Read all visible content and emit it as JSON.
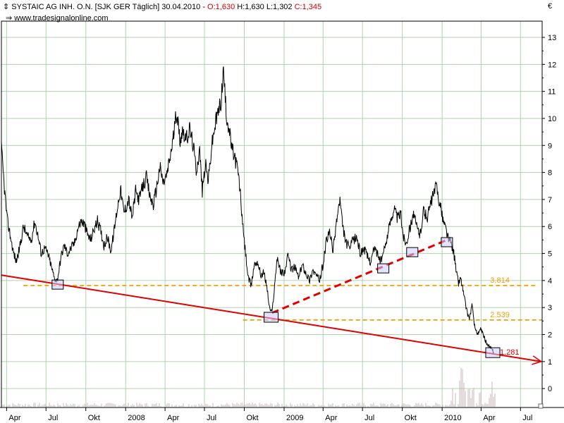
{
  "header": {
    "title": "SYSTAIC AG INH. O.N. [SJK GER  Täglich] 30.04.2010 - ",
    "open": "O:1,630",
    "high": "H:1,630",
    "low": "L:1,302",
    "close": "C:1,345",
    "source": "www.tradesignalonline.com",
    "currency": "€"
  },
  "colors": {
    "price": "#000000",
    "grid": "#b0d0b0",
    "trend": "#e00000",
    "level": "#f0a000",
    "box": "#ccccff",
    "volume": "#c8b8b8"
  },
  "chart_data": {
    "type": "line",
    "title": "SYSTAIC AG INH. O.N. [SJK GER  Täglich] 30.04.2010",
    "xlabel": "",
    "ylabel": "€",
    "xlim": [
      "2007-03-20",
      "2010-08-20"
    ],
    "ylim": [
      -0.7,
      13.6
    ],
    "yticks": [
      0,
      1,
      2,
      3,
      4,
      5,
      6,
      7,
      8,
      9,
      10,
      11,
      12,
      13
    ],
    "xticks": [
      {
        "label": "Apr",
        "date": "2007-04-01"
      },
      {
        "label": "Jul",
        "date": "2007-07-01"
      },
      {
        "label": "Okt",
        "date": "2007-10-01"
      },
      {
        "label": "2008",
        "date": "2008-01-01"
      },
      {
        "label": "Apr",
        "date": "2008-04-01"
      },
      {
        "label": "Jul",
        "date": "2008-07-01"
      },
      {
        "label": "Okt",
        "date": "2008-10-01"
      },
      {
        "label": "2009",
        "date": "2009-01-01"
      },
      {
        "label": "Apr",
        "date": "2009-04-01"
      },
      {
        "label": "Jul",
        "date": "2009-07-01"
      },
      {
        "label": "Okt",
        "date": "2009-10-01"
      },
      {
        "label": "2010",
        "date": "2010-01-01"
      },
      {
        "label": "Apr",
        "date": "2010-04-01"
      },
      {
        "label": "Jul",
        "date": "2010-07-01"
      }
    ],
    "grid": true,
    "series": [
      {
        "values": [
          [
            "2007-03-20",
            8.9
          ],
          [
            "2007-03-26",
            7.6
          ],
          [
            "2007-04-02",
            6.3
          ],
          [
            "2007-04-09",
            5.7
          ],
          [
            "2007-04-16",
            5.1
          ],
          [
            "2007-04-23",
            4.7
          ],
          [
            "2007-05-01",
            5.2
          ],
          [
            "2007-05-10",
            6.0
          ],
          [
            "2007-05-20",
            5.6
          ],
          [
            "2007-05-28",
            5.5
          ],
          [
            "2007-06-05",
            6.2
          ],
          [
            "2007-06-12",
            5.7
          ],
          [
            "2007-06-20",
            5.0
          ],
          [
            "2007-06-28",
            5.2
          ],
          [
            "2007-07-05",
            5.0
          ],
          [
            "2007-07-12",
            4.6
          ],
          [
            "2007-07-20",
            4.1
          ],
          [
            "2007-07-27",
            4.0
          ],
          [
            "2007-08-05",
            4.9
          ],
          [
            "2007-08-12",
            5.3
          ],
          [
            "2007-08-20",
            5.0
          ],
          [
            "2007-08-28",
            5.2
          ],
          [
            "2007-09-05",
            5.4
          ],
          [
            "2007-09-12",
            5.9
          ],
          [
            "2007-09-20",
            6.2
          ],
          [
            "2007-09-27",
            6.1
          ],
          [
            "2007-10-05",
            5.7
          ],
          [
            "2007-10-12",
            5.5
          ],
          [
            "2007-10-20",
            5.9
          ],
          [
            "2007-10-28",
            6.2
          ],
          [
            "2007-11-05",
            5.8
          ],
          [
            "2007-11-12",
            5.3
          ],
          [
            "2007-11-20",
            5.6
          ],
          [
            "2007-11-28",
            5.1
          ],
          [
            "2007-12-05",
            5.8
          ],
          [
            "2007-12-12",
            6.6
          ],
          [
            "2007-12-20",
            7.4
          ],
          [
            "2007-12-28",
            6.5
          ],
          [
            "2008-01-08",
            7.0
          ],
          [
            "2008-01-16",
            6.3
          ],
          [
            "2008-01-24",
            7.3
          ],
          [
            "2008-02-01",
            7.0
          ],
          [
            "2008-02-10",
            7.5
          ],
          [
            "2008-02-18",
            7.8
          ],
          [
            "2008-02-26",
            7.1
          ],
          [
            "2008-03-05",
            6.8
          ],
          [
            "2008-03-12",
            7.4
          ],
          [
            "2008-03-20",
            8.2
          ],
          [
            "2008-03-28",
            7.6
          ],
          [
            "2008-04-05",
            7.9
          ],
          [
            "2008-04-12",
            8.5
          ],
          [
            "2008-04-20",
            9.3
          ],
          [
            "2008-04-28",
            10.3
          ],
          [
            "2008-05-05",
            9.2
          ],
          [
            "2008-05-12",
            9.6
          ],
          [
            "2008-05-20",
            9.2
          ],
          [
            "2008-05-28",
            9.6
          ],
          [
            "2008-06-05",
            9.0
          ],
          [
            "2008-06-12",
            8.1
          ],
          [
            "2008-06-20",
            8.8
          ],
          [
            "2008-06-26",
            7.3
          ],
          [
            "2008-07-03",
            8.3
          ],
          [
            "2008-07-10",
            7.7
          ],
          [
            "2008-07-18",
            9.0
          ],
          [
            "2008-07-25",
            9.7
          ],
          [
            "2008-08-01",
            10.2
          ],
          [
            "2008-08-08",
            10.6
          ],
          [
            "2008-08-14",
            11.8
          ],
          [
            "2008-08-20",
            10.2
          ],
          [
            "2008-08-26",
            9.7
          ],
          [
            "2008-09-02",
            8.9
          ],
          [
            "2008-09-10",
            8.5
          ],
          [
            "2008-09-16",
            8.1
          ],
          [
            "2008-09-22",
            7.2
          ],
          [
            "2008-09-28",
            5.9
          ],
          [
            "2008-10-04",
            5.0
          ],
          [
            "2008-10-10",
            4.1
          ],
          [
            "2008-10-17",
            3.8
          ],
          [
            "2008-10-24",
            4.6
          ],
          [
            "2008-11-01",
            4.7
          ],
          [
            "2008-11-08",
            4.2
          ],
          [
            "2008-11-15",
            4.3
          ],
          [
            "2008-11-22",
            3.8
          ],
          [
            "2008-11-28",
            3.0
          ],
          [
            "2008-12-04",
            2.8
          ],
          [
            "2008-12-10",
            3.8
          ],
          [
            "2008-12-16",
            4.9
          ],
          [
            "2008-12-24",
            4.3
          ],
          [
            "2009-01-02",
            4.3
          ],
          [
            "2009-01-10",
            4.9
          ],
          [
            "2009-01-18",
            4.4
          ],
          [
            "2009-01-26",
            4.5
          ],
          [
            "2009-02-04",
            4.1
          ],
          [
            "2009-02-12",
            4.6
          ],
          [
            "2009-02-20",
            4.3
          ],
          [
            "2009-03-01",
            4.0
          ],
          [
            "2009-03-08",
            4.4
          ],
          [
            "2009-03-16",
            4.2
          ],
          [
            "2009-03-24",
            4.0
          ],
          [
            "2009-04-01",
            4.6
          ],
          [
            "2009-04-08",
            5.4
          ],
          [
            "2009-04-16",
            5.8
          ],
          [
            "2009-04-24",
            5.1
          ],
          [
            "2009-05-02",
            6.2
          ],
          [
            "2009-05-10",
            7.0
          ],
          [
            "2009-05-16",
            6.0
          ],
          [
            "2009-05-24",
            5.4
          ],
          [
            "2009-06-01",
            5.2
          ],
          [
            "2009-06-10",
            5.5
          ],
          [
            "2009-06-18",
            5.6
          ],
          [
            "2009-06-26",
            5.0
          ],
          [
            "2009-07-04",
            5.2
          ],
          [
            "2009-07-12",
            4.9
          ],
          [
            "2009-07-20",
            4.7
          ],
          [
            "2009-07-28",
            5.2
          ],
          [
            "2009-08-05",
            5.0
          ],
          [
            "2009-08-12",
            4.7
          ],
          [
            "2009-08-20",
            5.1
          ],
          [
            "2009-08-28",
            5.7
          ],
          [
            "2009-09-05",
            6.3
          ],
          [
            "2009-09-12",
            6.7
          ],
          [
            "2009-09-20",
            6.3
          ],
          [
            "2009-09-27",
            6.5
          ],
          [
            "2009-10-04",
            5.6
          ],
          [
            "2009-10-10",
            5.4
          ],
          [
            "2009-10-18",
            5.9
          ],
          [
            "2009-10-26",
            6.5
          ],
          [
            "2009-11-03",
            6.0
          ],
          [
            "2009-11-11",
            5.7
          ],
          [
            "2009-11-19",
            6.6
          ],
          [
            "2009-11-27",
            6.3
          ],
          [
            "2009-12-05",
            6.8
          ],
          [
            "2009-12-12",
            7.2
          ],
          [
            "2009-12-19",
            7.5
          ],
          [
            "2009-12-27",
            6.8
          ],
          [
            "2010-01-04",
            6.2
          ],
          [
            "2010-01-10",
            5.9
          ],
          [
            "2010-01-16",
            5.5
          ],
          [
            "2010-01-22",
            5.4
          ],
          [
            "2010-01-28",
            5.0
          ],
          [
            "2010-02-03",
            4.3
          ],
          [
            "2010-02-08",
            3.9
          ],
          [
            "2010-02-13",
            4.1
          ],
          [
            "2010-02-22",
            3.3
          ],
          [
            "2010-02-28",
            2.8
          ],
          [
            "2010-03-05",
            2.6
          ],
          [
            "2010-03-11",
            3.1
          ],
          [
            "2010-03-17",
            2.3
          ],
          [
            "2010-03-24",
            2.0
          ],
          [
            "2010-03-31",
            2.2
          ],
          [
            "2010-04-08",
            1.9
          ],
          [
            "2010-04-16",
            1.6
          ],
          [
            "2010-04-23",
            1.5
          ],
          [
            "2010-04-30",
            1.345
          ]
        ]
      }
    ],
    "annotations": [
      {
        "type": "trendline",
        "style": "solid",
        "from": [
          "2007-03-20",
          4.2
        ],
        "to": [
          "2010-08-18",
          1.0
        ],
        "arrow": true
      },
      {
        "type": "trendline",
        "style": "dashed",
        "from": [
          "2008-12-04",
          2.8
        ],
        "to": [
          "2010-01-12",
          5.5
        ]
      },
      {
        "type": "level",
        "value": 3.814,
        "label": "3.814",
        "from": "2007-05-10",
        "to": "2010-08-05"
      },
      {
        "type": "level",
        "value": 2.539,
        "label": "2.539",
        "from": "2008-09-28",
        "to": "2010-08-20"
      },
      {
        "type": "level_label",
        "value": 1.281,
        "label": "1.281",
        "at": "2010-04-28"
      },
      {
        "type": "marker",
        "date": "2007-07-28",
        "value": 3.85
      },
      {
        "type": "marker",
        "date": "2008-12-02",
        "value": 2.64
      },
      {
        "type": "marker",
        "date": "2009-08-18",
        "value": 4.45
      },
      {
        "type": "marker",
        "date": "2009-10-24",
        "value": 5.05
      },
      {
        "type": "marker",
        "date": "2010-01-12",
        "value": 5.42
      },
      {
        "type": "marker",
        "date": "2010-04-28",
        "value": 1.33
      }
    ]
  }
}
